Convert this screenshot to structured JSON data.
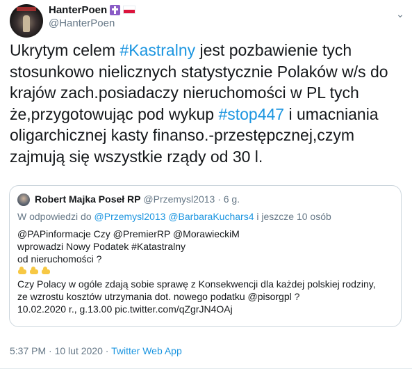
{
  "tweet": {
    "display_name": "HanterPoen",
    "handle": "@HanterPoen",
    "body": [
      {
        "t": "Ukrytym celem "
      },
      {
        "t": "#Kastralny",
        "tag": true
      },
      {
        "t": " jest pozbawienie tych stosunkowo nielicznych statystycznie Polaków w/s do krajów zach.posiadaczy nieruchomości w PL tych że,przygotowując pod wykup "
      },
      {
        "t": "#stop447",
        "tag": true
      },
      {
        "t": " i umacniania oligarchicznej kasty finanso.-przestępcznej,czym zajmują się wszystkie rządy od 30 l."
      }
    ],
    "timestamp": "5:37 PM · 10 lut 2020",
    "separator": " · ",
    "source": "Twitter Web App"
  },
  "quote": {
    "name": "Robert Majka Poseł RP",
    "meta": "@Przemysl2013 · 6 g.",
    "reply_prefix": "W odpowiedzi do ",
    "reply_users": "@Przemysl2013 @BarbaraKuchars4",
    "reply_suffix": "  i jeszcze 10 osób",
    "lines": [
      "@PAPinformacje Czy @PremierRP @MorawieckiM",
      " wprowadzi Nowy Podatek #Katastralny",
      "od nieruchomości ?"
    ],
    "lines2": [
      "Czy Polacy w ogóle zdają sobie sprawę z Konsekwencji dla każdej polskiej rodziny,",
      "ze wzrostu kosztów utrzymania dot. nowego podatku @pisorgpl  ?",
      "10.02.2020 r., g.13.00 pic.twitter.com/qZgrJN4OAj"
    ]
  },
  "icons": [
    "avatar",
    "cross-badge-icon",
    "poland-flag-icon",
    "chevron-down-icon",
    "pointing-down-icon"
  ],
  "colors": {
    "link": "#1b95e0",
    "muted": "#657786",
    "text": "#14171a"
  }
}
